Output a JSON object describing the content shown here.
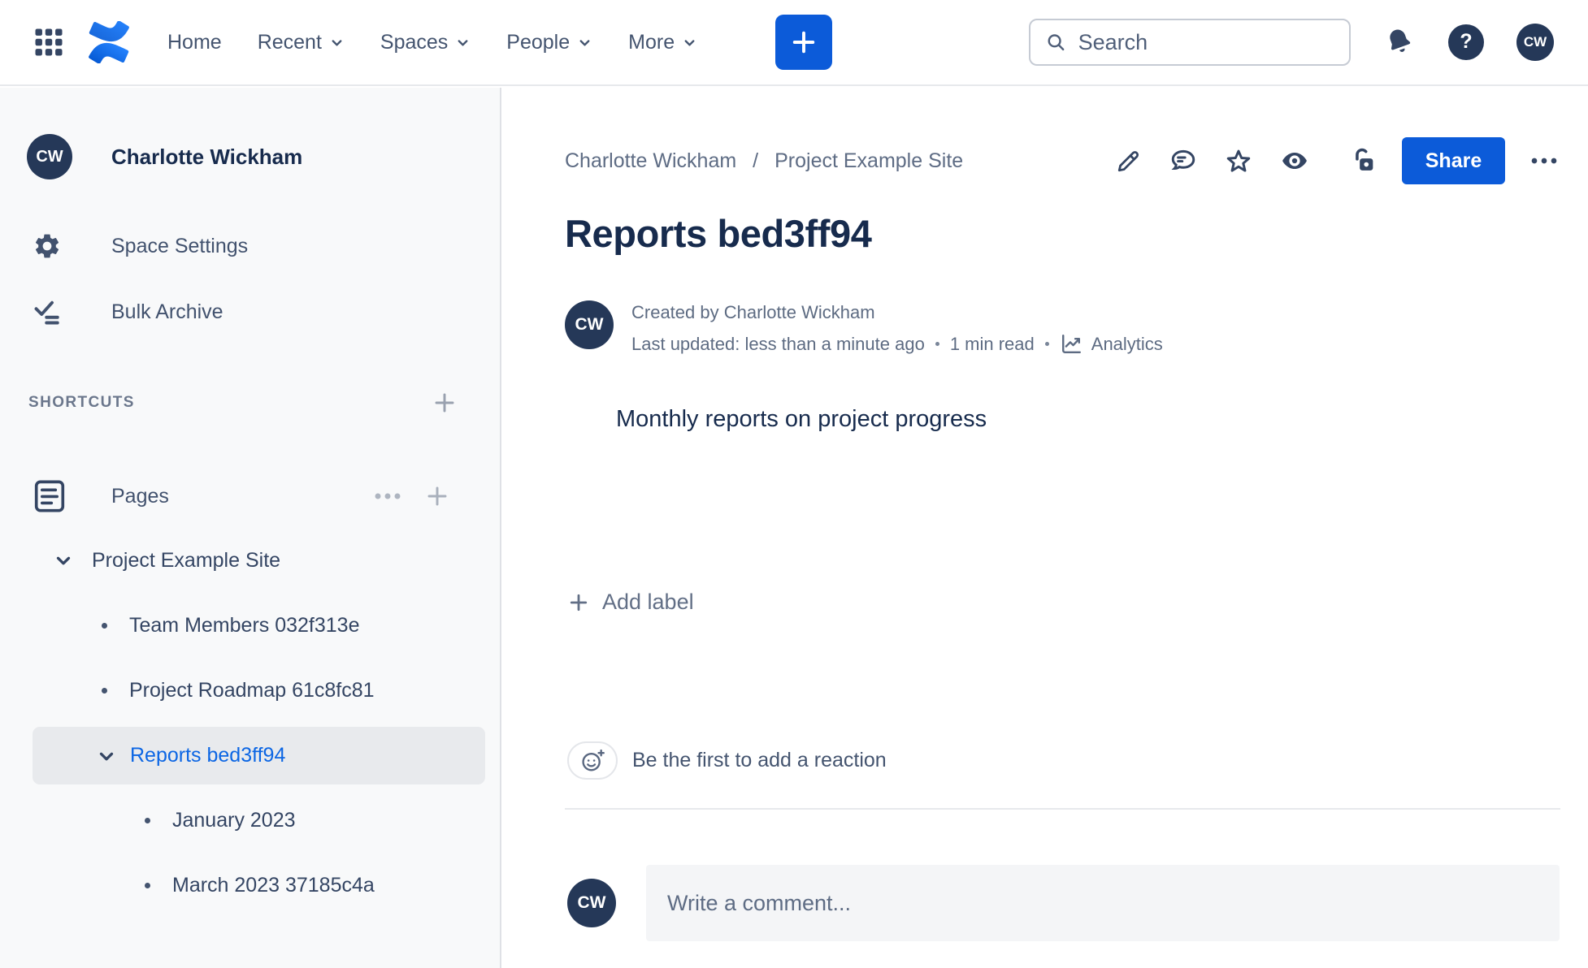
{
  "topnav": {
    "menu": [
      {
        "label": "Home",
        "chevron": false
      },
      {
        "label": "Recent",
        "chevron": true
      },
      {
        "label": "Spaces",
        "chevron": true
      },
      {
        "label": "People",
        "chevron": true
      },
      {
        "label": "More",
        "chevron": true
      }
    ],
    "search": {
      "placeholder": "Search"
    },
    "avatar_initials": "CW"
  },
  "sidebar": {
    "user": {
      "initials": "CW",
      "name": "Charlotte Wickham"
    },
    "items": [
      {
        "label": "Space Settings",
        "icon": "gear-icon"
      },
      {
        "label": "Bulk Archive",
        "icon": "bulk-archive-icon"
      }
    ],
    "shortcuts": {
      "header": "SHORTCUTS"
    },
    "pages": {
      "label": "Pages"
    },
    "tree": {
      "root": {
        "label": "Project Example Site"
      },
      "children": [
        {
          "label": "Team Members 032f313e",
          "selected": false
        },
        {
          "label": "Project Roadmap 61c8fc81",
          "selected": false
        },
        {
          "label": "Reports bed3ff94",
          "selected": true
        }
      ],
      "reports_children": [
        {
          "label": "January 2023"
        },
        {
          "label": "March 2023 37185c4a"
        }
      ]
    }
  },
  "page": {
    "breadcrumb": [
      {
        "label": "Charlotte Wickham"
      },
      {
        "label": "Project Example Site"
      }
    ],
    "breadcrumb_separator": "/",
    "share_label": "Share",
    "title": "Reports bed3ff94",
    "byline": {
      "initials": "CW",
      "created": "Created by Charlotte Wickham",
      "updated": "Last updated: less than a minute ago",
      "read_time": "1 min read",
      "analytics_label": "Analytics"
    },
    "body_text": "Monthly reports on project progress",
    "add_label_text": "Add label",
    "reactions_text": "Be the first to add a reaction",
    "comment": {
      "initials": "CW",
      "placeholder": "Write a comment..."
    }
  },
  "icons": {
    "app-grid-icon": "3x3 dot grid",
    "confluence-logo": "two blue curved ribbons",
    "chevron-down-icon": "v",
    "plus-icon": "+",
    "search-icon": "magnifier",
    "bell-icon": "notification bell",
    "help-icon": "?",
    "gear-icon": "settings cog",
    "bulk-archive-icon": "check with lines",
    "pages-icon": "document with lines",
    "ellipsis-icon": "...",
    "edit-pencil-icon": "pencil",
    "comment-bubble-icon": "speech bubble",
    "star-icon": "star outline",
    "watch-eye-icon": "filled eye",
    "unlock-icon": "open padlock",
    "analytics-icon": "trend chart",
    "emoji-add-icon": "smiley with plus"
  },
  "colors": {
    "accent_blue": "#0C5BD9",
    "link_blue": "#0C66E4",
    "avatar_navy": "#253858",
    "heading_navy": "#172B4D",
    "icon_navy": "#344563",
    "muted_gray": "#626F86",
    "sidebar_bg": "#F8F9FA",
    "selected_row_bg": "#E8EAED",
    "divider": "#DFE1E6",
    "logo_blue_dark": "#0052CC",
    "logo_blue_light": "#2684FF"
  }
}
